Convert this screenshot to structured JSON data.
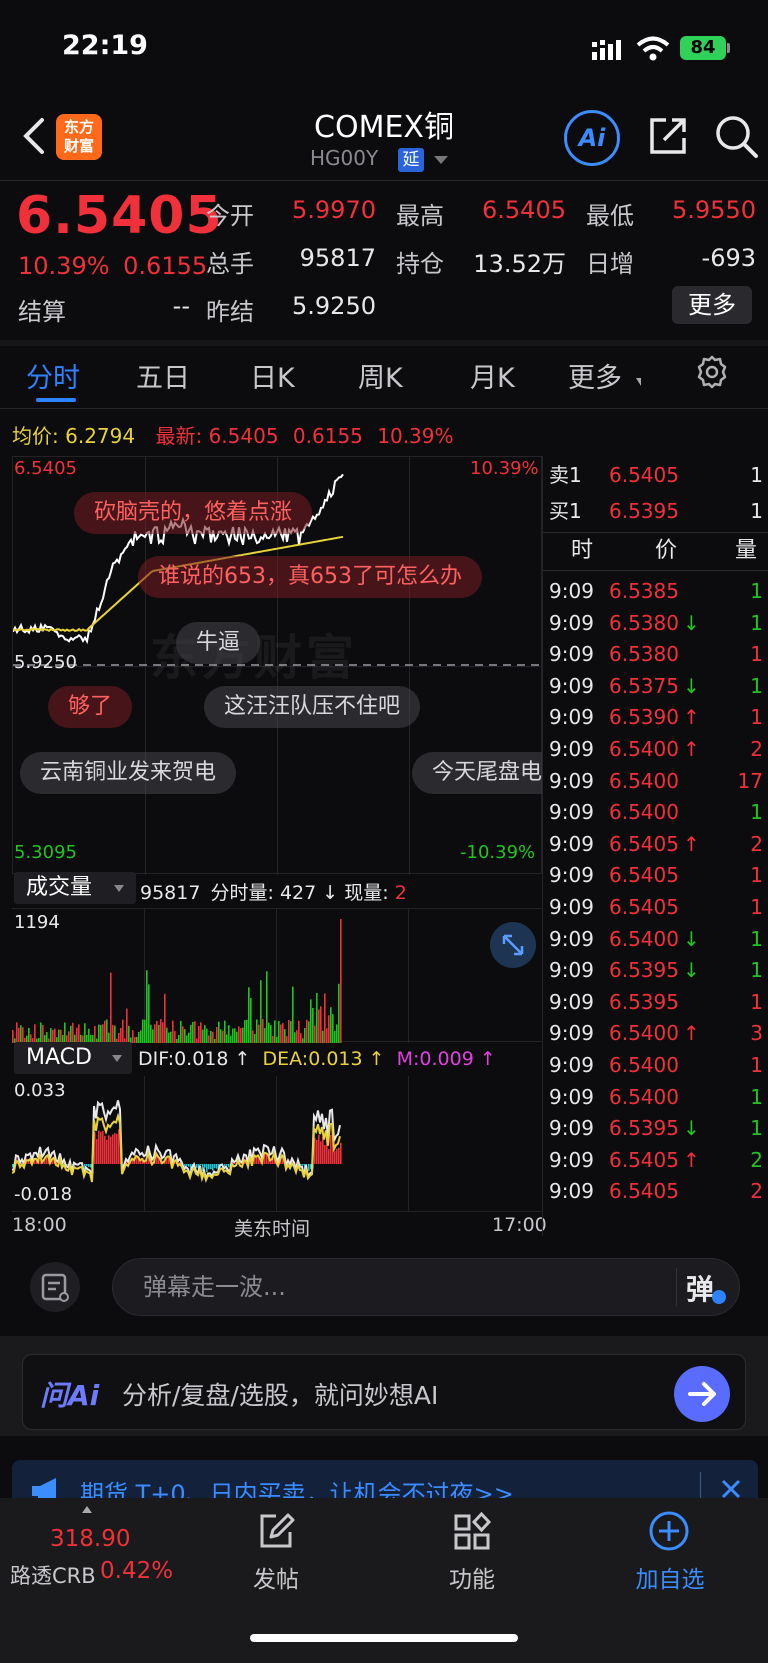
{
  "status": {
    "time": "22:19",
    "battery": "84"
  },
  "header": {
    "title": "COMEX铜",
    "code": "HG00Y",
    "delay_badge": "延",
    "logo_line1": "东方",
    "logo_line2": "财富",
    "ai_label": "Ai"
  },
  "quote": {
    "price": "6.5405",
    "change_pct": "10.39%",
    "change_val": "0.6155",
    "fields": [
      {
        "label": "今开",
        "value": "5.9970",
        "color": "red"
      },
      {
        "label": "最高",
        "value": "6.5405",
        "color": "red"
      },
      {
        "label": "最低",
        "value": "5.9550",
        "color": "red"
      },
      {
        "label": "总手",
        "value": "95817",
        "color": "white"
      },
      {
        "label": "持仓",
        "value": "13.52万",
        "color": "white"
      },
      {
        "label": "日增",
        "value": "-693",
        "color": "white"
      },
      {
        "label": "结算",
        "value": "--",
        "color": "white"
      },
      {
        "label": "昨结",
        "value": "5.9250",
        "color": "white"
      }
    ],
    "more_label": "更多"
  },
  "tabs": [
    "分时",
    "五日",
    "日K",
    "周K",
    "月K",
    "更多"
  ],
  "chart": {
    "avg_label": "均价:",
    "avg_value": "6.2794",
    "latest_label": "最新:",
    "latest_value": "6.5405",
    "latest_change": "0.6155",
    "latest_pct": "10.39%",
    "y_top": "6.5405",
    "y_top_pct": "10.39%",
    "y_mid": "5.9250",
    "y_bottom": "5.3095",
    "y_bottom_pct": "-10.39%",
    "watermark": "东方财富",
    "danmu": [
      {
        "text": "砍脑壳的，悠着点涨",
        "style": "red"
      },
      {
        "text": "谁说的653，真653了可怎么办",
        "style": "red"
      },
      {
        "text": "牛逼",
        "style": "gray"
      },
      {
        "text": "够了",
        "style": "red"
      },
      {
        "text": "这汪汪队压不住吧",
        "style": "gray"
      },
      {
        "text": "云南铜业发来贺电",
        "style": "gray"
      },
      {
        "text": "今天尾盘电",
        "style": "gray"
      }
    ]
  },
  "volume": {
    "selector": "成交量",
    "total": "95817",
    "fen_label": "分时量:",
    "fen_value": "427",
    "now_label": "现量:",
    "now_value": "2",
    "y_max": "1194"
  },
  "macd": {
    "selector": "MACD",
    "dif": "DIF:0.018",
    "dea": "DEA:0.013",
    "m": "M:0.009",
    "arrow": "↑",
    "y_top": "0.033",
    "y_bottom": "-0.018"
  },
  "time_axis": {
    "start": "18:00",
    "mid": "美东时间",
    "end": "17:00"
  },
  "order_book": {
    "ask": {
      "label": "卖1",
      "price": "6.5405",
      "qty": "1"
    },
    "bid": {
      "label": "买1",
      "price": "6.5395",
      "qty": "1"
    },
    "headers": [
      "时",
      "价",
      "量"
    ],
    "ticks": [
      {
        "t": "9:09",
        "p": "6.5385",
        "d": "",
        "q": "1",
        "qc": "green"
      },
      {
        "t": "9:09",
        "p": "6.5380",
        "d": "↓",
        "q": "1",
        "qc": "green"
      },
      {
        "t": "9:09",
        "p": "6.5380",
        "d": "",
        "q": "1",
        "qc": "red"
      },
      {
        "t": "9:09",
        "p": "6.5375",
        "d": "↓",
        "q": "1",
        "qc": "green"
      },
      {
        "t": "9:09",
        "p": "6.5390",
        "d": "↑",
        "q": "1",
        "qc": "red"
      },
      {
        "t": "9:09",
        "p": "6.5400",
        "d": "↑",
        "q": "2",
        "qc": "red"
      },
      {
        "t": "9:09",
        "p": "6.5400",
        "d": "",
        "q": "17",
        "qc": "red"
      },
      {
        "t": "9:09",
        "p": "6.5400",
        "d": "",
        "q": "1",
        "qc": "green"
      },
      {
        "t": "9:09",
        "p": "6.5405",
        "d": "↑",
        "q": "2",
        "qc": "red"
      },
      {
        "t": "9:09",
        "p": "6.5405",
        "d": "",
        "q": "1",
        "qc": "red"
      },
      {
        "t": "9:09",
        "p": "6.5405",
        "d": "",
        "q": "1",
        "qc": "red"
      },
      {
        "t": "9:09",
        "p": "6.5400",
        "d": "↓",
        "q": "1",
        "qc": "green"
      },
      {
        "t": "9:09",
        "p": "6.5395",
        "d": "↓",
        "q": "1",
        "qc": "green"
      },
      {
        "t": "9:09",
        "p": "6.5395",
        "d": "",
        "q": "1",
        "qc": "red"
      },
      {
        "t": "9:09",
        "p": "6.5400",
        "d": "↑",
        "q": "3",
        "qc": "red"
      },
      {
        "t": "9:09",
        "p": "6.5400",
        "d": "",
        "q": "1",
        "qc": "red"
      },
      {
        "t": "9:09",
        "p": "6.5400",
        "d": "",
        "q": "1",
        "qc": "green"
      },
      {
        "t": "9:09",
        "p": "6.5395",
        "d": "↓",
        "q": "1",
        "qc": "green"
      },
      {
        "t": "9:09",
        "p": "6.5405",
        "d": "↑",
        "q": "2",
        "qc": "green"
      },
      {
        "t": "9:09",
        "p": "6.5405",
        "d": "",
        "q": "2",
        "qc": "red"
      }
    ]
  },
  "danmu_input": {
    "placeholder": "弹幕走一波...",
    "send_label": "弹"
  },
  "ai_ask": {
    "logo": "问Ai",
    "prompt": "分析/复盘/选股，就问妙想AI"
  },
  "promo": {
    "text": "期货 T+0、日内买卖，让机会不过夜>>"
  },
  "tabbar": {
    "crb_value": "318.90",
    "crb_label": "路透CRB",
    "crb_pct": "0.42%",
    "post_label": "发帖",
    "func_label": "功能",
    "add_label": "加自选"
  },
  "colors": {
    "up": "#f0303a",
    "down": "#1fc41f",
    "accent": "#2e82ff",
    "avg_line": "#e8d23a"
  }
}
